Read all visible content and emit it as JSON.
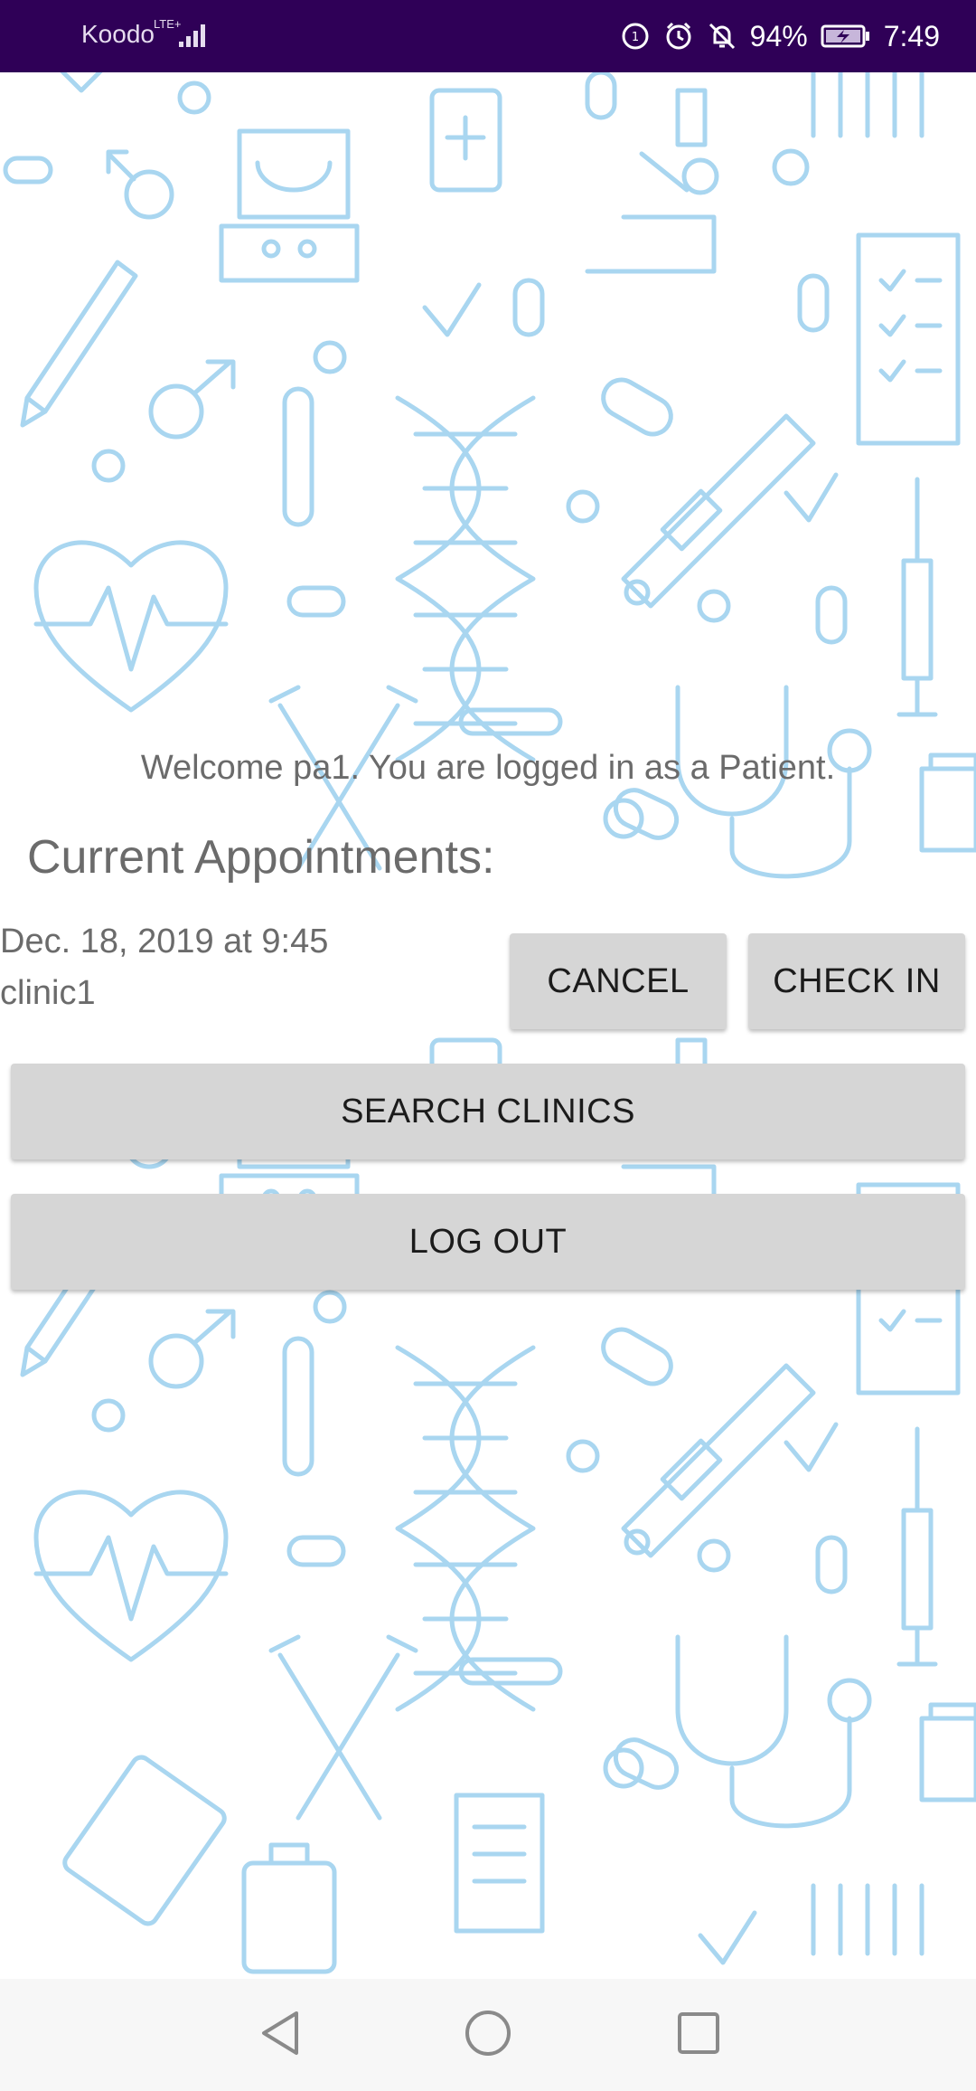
{
  "status_bar": {
    "carrier": "Koodo",
    "network": "LTE+",
    "battery": "94%",
    "time": "7:49",
    "icons": [
      "signal-icon",
      "data-saver-icon",
      "alarm-icon",
      "mute-icon",
      "battery-charging-icon"
    ]
  },
  "main": {
    "welcome": "Welcome pa1. You are logged in as a Patient.",
    "section_title": "Current Appointments:",
    "appointment": {
      "datetime": "Dec. 18, 2019 at 9:45",
      "clinic": "clinic1",
      "cancel_label": "CANCEL",
      "checkin_label": "CHECK IN"
    },
    "search_label": "SEARCH CLINICS",
    "logout_label": "LOG OUT"
  },
  "nav_bar": {
    "icons": [
      "back-icon",
      "home-icon",
      "recents-icon"
    ]
  },
  "colors": {
    "status_bar": "#2f0057",
    "button_bg": "#d6d6d6",
    "text_gray": "#6b6b6b",
    "pattern": "#a9d6f0"
  }
}
